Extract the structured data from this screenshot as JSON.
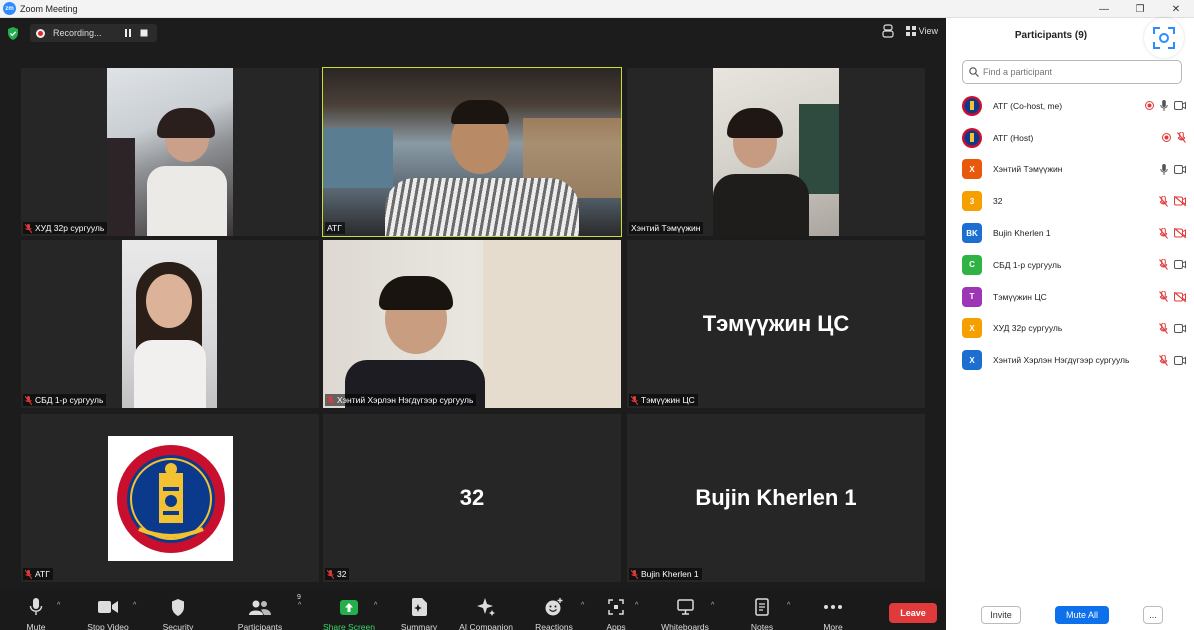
{
  "window": {
    "app_logo": "zm",
    "title": "Zoom Meeting",
    "controls": [
      "—",
      "❐",
      "✕"
    ]
  },
  "topbar": {
    "recording_label": "Recording...",
    "view_label": "View"
  },
  "tiles": [
    {
      "name": "ХУД 32р сургууль",
      "kind": "video"
    },
    {
      "name": "АТГ",
      "kind": "video",
      "speaking": true
    },
    {
      "name": "Хэнтий Тэмүүжин",
      "kind": "video"
    },
    {
      "name": "СБД 1-р сургууль",
      "kind": "video"
    },
    {
      "name": "Хэнтий Хэрлэн Нэгдүгээр сургууль",
      "kind": "video"
    },
    {
      "name": "Тэмүүжин ЦС",
      "kind": "name",
      "display": "Тэмүүжин ЦС"
    },
    {
      "name": "АТГ",
      "kind": "logo"
    },
    {
      "name": "32",
      "kind": "name",
      "display": "32"
    },
    {
      "name": "Bujin Kherlen 1",
      "kind": "name",
      "display": "Bujin Kherlen 1"
    }
  ],
  "toolbar": {
    "items": [
      {
        "label": "Mute",
        "icon": "microphone-icon"
      },
      {
        "label": "Stop Video",
        "icon": "video-camera-icon"
      },
      {
        "label": "Security",
        "icon": "shield-icon"
      },
      {
        "label": "Participants",
        "icon": "participants-icon",
        "count": "9"
      },
      {
        "label": "Share Screen",
        "icon": "share-screen-icon"
      },
      {
        "label": "Summary",
        "icon": "summary-icon"
      },
      {
        "label": "AI Companion",
        "icon": "ai-companion-icon"
      },
      {
        "label": "Reactions",
        "icon": "reactions-icon"
      },
      {
        "label": "Apps",
        "icon": "apps-icon"
      },
      {
        "label": "Whiteboards",
        "icon": "whiteboard-icon"
      },
      {
        "label": "Notes",
        "icon": "notes-icon"
      },
      {
        "label": "More",
        "icon": "more-icon"
      }
    ],
    "leave_label": "Leave"
  },
  "panel": {
    "title": "Participants (9)",
    "search_placeholder": "Find a participant",
    "participants": [
      {
        "name": "АТГ (Co-host, me)",
        "avatar": "emblem",
        "color": "#1c3f8f",
        "rec": true,
        "mic": "on",
        "video": "on"
      },
      {
        "name": "АТГ (Host)",
        "avatar": "emblem",
        "color": "#1c3f8f",
        "rec": true,
        "mic": "muted",
        "video": "none"
      },
      {
        "name": "Хэнтий Тэмүүжин",
        "avatar": "Х",
        "color": "#e8590c",
        "rec": false,
        "mic": "on",
        "video": "on"
      },
      {
        "name": "32",
        "avatar": "3",
        "color": "#f59f00",
        "rec": false,
        "mic": "muted",
        "video": "off"
      },
      {
        "name": "Bujin Kherlen 1",
        "avatar": "BK",
        "color": "#1c6fd1",
        "rec": false,
        "mic": "muted",
        "video": "off"
      },
      {
        "name": "СБД 1-р сургууль",
        "avatar": "С",
        "color": "#2fb344",
        "rec": false,
        "mic": "muted",
        "video": "on"
      },
      {
        "name": "Тэмүүжин ЦС",
        "avatar": "Т",
        "color": "#9c36b5",
        "rec": false,
        "mic": "muted",
        "video": "off"
      },
      {
        "name": "ХУД 32р сургууль",
        "avatar": "Х",
        "color": "#f59f00",
        "rec": false,
        "mic": "muted",
        "video": "on"
      },
      {
        "name": "Хэнтий Хэрлэн Нэгдүгээр сургууль",
        "avatar": "Х",
        "color": "#1c6fd1",
        "rec": false,
        "mic": "muted",
        "video": "on"
      }
    ],
    "invite_label": "Invite",
    "mute_all_label": "Mute All",
    "more_label": "..."
  }
}
